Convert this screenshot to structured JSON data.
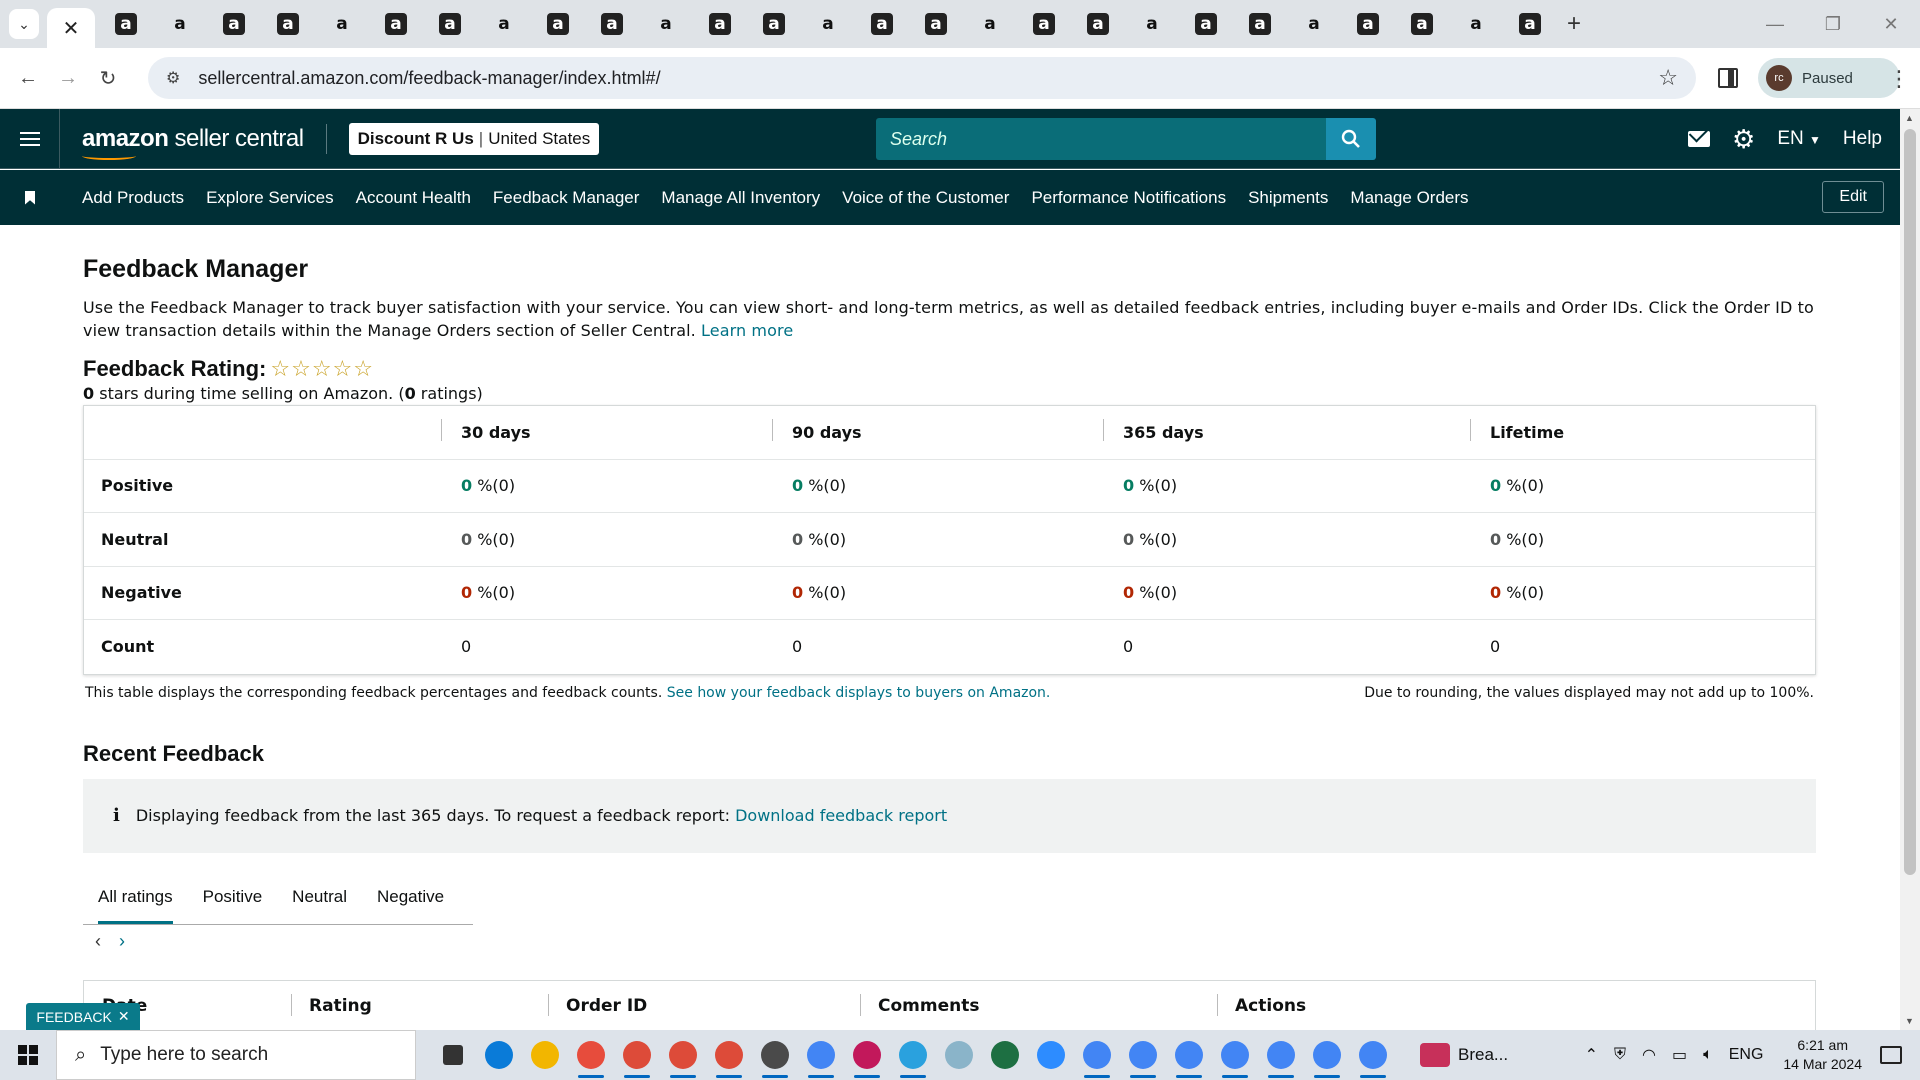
{
  "browser": {
    "url": "sellercentral.amazon.com/feedback-manager/index.html#/",
    "profile_initials": "rc",
    "profile_status": "Paused",
    "tab_favicons": [
      "a",
      "a",
      "a",
      "a",
      "a",
      "a",
      "a",
      "a",
      "a",
      "a",
      "a",
      "a",
      "a",
      "a",
      "a",
      "a",
      "a",
      "a",
      "a",
      "a",
      "a",
      "a",
      "a",
      "a",
      "a",
      "a",
      "a"
    ]
  },
  "header": {
    "logo_brand": "amazon",
    "logo_suffix": " seller central",
    "store_name": "Discount R Us",
    "store_region": "United States",
    "search_placeholder": "Search",
    "language": "EN",
    "help": "Help"
  },
  "nav": {
    "items": [
      "Add Products",
      "Explore Services",
      "Account Health",
      "Feedback Manager",
      "Manage All Inventory",
      "Voice of the Customer",
      "Performance Notifications",
      "Shipments",
      "Manage Orders"
    ],
    "edit": "Edit"
  },
  "page": {
    "title": "Feedback Manager",
    "description": "Use the Feedback Manager to track buyer satisfaction with your service. You can view short- and long-term metrics, as well as detailed feedback entries, including buyer e-mails and Order IDs. Click the Order ID to view transaction details within the Manage Orders section of Seller Central.",
    "learn_more": "Learn more",
    "rating_title": "Feedback Rating:",
    "rating_stars": 0,
    "rating_stars_glyphs": "☆☆☆☆☆",
    "rating_sub_stars": "0",
    "rating_sub_text1": " stars during time selling on Amazon. (",
    "rating_sub_count": "0",
    "rating_sub_text2": " ratings)"
  },
  "metrics": {
    "columns": [
      "30 days",
      "90 days",
      "365 days",
      "Lifetime"
    ],
    "rows": [
      {
        "label": "Positive",
        "kind": "pos",
        "values": [
          {
            "pct": "0",
            "rest": " %(0)"
          },
          {
            "pct": "0",
            "rest": " %(0)"
          },
          {
            "pct": "0",
            "rest": " %(0)"
          },
          {
            "pct": "0",
            "rest": " %(0)"
          }
        ]
      },
      {
        "label": "Neutral",
        "kind": "neu",
        "values": [
          {
            "pct": "0",
            "rest": " %(0)"
          },
          {
            "pct": "0",
            "rest": " %(0)"
          },
          {
            "pct": "0",
            "rest": " %(0)"
          },
          {
            "pct": "0",
            "rest": " %(0)"
          }
        ]
      },
      {
        "label": "Negative",
        "kind": "neg",
        "values": [
          {
            "pct": "0",
            "rest": " %(0)"
          },
          {
            "pct": "0",
            "rest": " %(0)"
          },
          {
            "pct": "0",
            "rest": " %(0)"
          },
          {
            "pct": "0",
            "rest": " %(0)"
          }
        ]
      }
    ],
    "count_label": "Count",
    "counts": [
      "0",
      "0",
      "0",
      "0"
    ],
    "footnote_left": "This table displays the corresponding feedback percentages and feedback counts.",
    "footnote_link": "See how your feedback displays to buyers on Amazon.",
    "footnote_right": "Due to rounding, the values displayed may not add up to 100%."
  },
  "recent": {
    "title": "Recent Feedback",
    "info_text": "Displaying feedback from the last 365 days. To request a feedback report:",
    "info_link": "Download feedback report",
    "tabs": [
      "All ratings",
      "Positive",
      "Neutral",
      "Negative"
    ],
    "active_tab": 0,
    "table_headers": [
      "Date",
      "Rating",
      "Order ID",
      "Comments",
      "Actions"
    ]
  },
  "feedback_tab": "FEEDBACK",
  "taskbar": {
    "search_placeholder": "Type here to search",
    "news_label": "Brea...",
    "language": "ENG",
    "time": "6:21 am",
    "date": "14 Mar 2024"
  },
  "colors": {
    "header_bg": "#002f36",
    "link": "#007185",
    "positive": "#067d62",
    "negative": "#b12704"
  }
}
